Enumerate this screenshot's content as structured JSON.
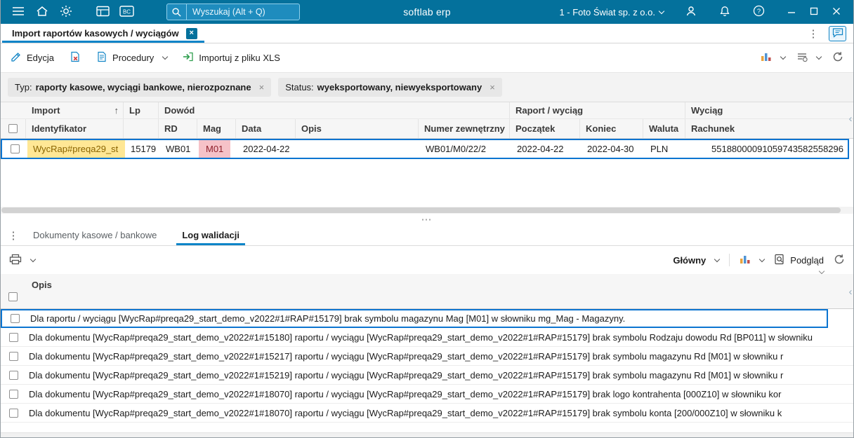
{
  "colors": {
    "topbar": "#04719c",
    "accent": "#0a84c8",
    "selection_border": "#0b74d0",
    "warning_bg": "#ffe795",
    "warning_text": "#8a6400",
    "error_bg": "#f6c2c8",
    "error_text": "#8e1f2a"
  },
  "icons": {
    "sort_asc": "↑",
    "kebab": "⋮",
    "ellipsis": "⋯",
    "scroll_left": "‹",
    "close": "×",
    "bc": "BC",
    "help": "?"
  },
  "topbar": {
    "app_name": "softlab erp",
    "search_placeholder": "Wyszukaj (Alt + Q)",
    "company": "1 - Foto Świat sp. z o.o."
  },
  "tab": {
    "title": "Import raportów kasowych / wyciągów"
  },
  "toolbar": {
    "edycja": "Edycja",
    "procedury": "Procedury",
    "import_xls": "Importuj z pliku XLS"
  },
  "filters": [
    {
      "label": "Typ:",
      "value": "raporty kasowe, wyciągi bankowe, nierozpoznane"
    },
    {
      "label": "Status:",
      "value": "wyeksportowany, niewyeksportowany"
    }
  ],
  "grid": {
    "groups": {
      "import": "Import",
      "lp": "Lp",
      "dowod": "Dowód",
      "raport": "Raport / wyciąg",
      "wyciag": "Wyciąg"
    },
    "cols": {
      "identyfikator": "Identyfikator",
      "rd": "RD",
      "mag": "Mag",
      "data": "Data",
      "opis": "Opis",
      "numer": "Numer zewnętrzny",
      "poczatek": "Początek",
      "koniec": "Koniec",
      "waluta": "Waluta",
      "rachunek": "Rachunek"
    },
    "row": {
      "identyfikator": "WycRap#preqa29_st",
      "lp": "15179",
      "rd": "WB01",
      "mag": "M01",
      "data": "2022-04-22",
      "opis": "",
      "numer": "WB01/M0/22/2",
      "poczatek": "2022-04-22",
      "koniec": "2022-04-30",
      "waluta": "PLN",
      "rachunek": "55188000091059743582558296"
    }
  },
  "bottom": {
    "tab_documents": "Dokumenty kasowe / bankowe",
    "tab_log": "Log walidacji",
    "view": "Główny",
    "preview": "Podgląd",
    "col_opis": "Opis",
    "rows": [
      "Dla raportu / wyciągu [WycRap#preqa29_start_demo_v2022#1#RAP#15179] brak symbolu magazynu Mag [M01] w słowniku mg_Mag - Magazyny.",
      "Dla dokumentu [WycRap#preqa29_start_demo_v2022#1#15180] raportu / wyciągu [WycRap#preqa29_start_demo_v2022#1#RAP#15179] brak symbolu Rodzaju dowodu Rd [BP011] w słowniku",
      "Dla dokumentu [WycRap#preqa29_start_demo_v2022#1#15217] raportu / wyciągu [WycRap#preqa29_start_demo_v2022#1#RAP#15179] brak symbolu magazynu Rd [M01] w słowniku r",
      "Dla dokumentu [WycRap#preqa29_start_demo_v2022#1#15219] raportu / wyciągu [WycRap#preqa29_start_demo_v2022#1#RAP#15179] brak symbolu magazynu Rd [M01] w słowniku r",
      "Dla dokumentu [WycRap#preqa29_start_demo_v2022#1#18070] raportu / wyciągu [WycRap#preqa29_start_demo_v2022#1#RAP#15179] brak logo kontrahenta [000Z10] w słowniku kor",
      "Dla dokumentu [WycRap#preqa29_start_demo_v2022#1#18070] raportu / wyciągu [WycRap#preqa29_start_demo_v2022#1#RAP#15179] brak symbolu konta [200/000Z10] w słowniku k"
    ]
  }
}
